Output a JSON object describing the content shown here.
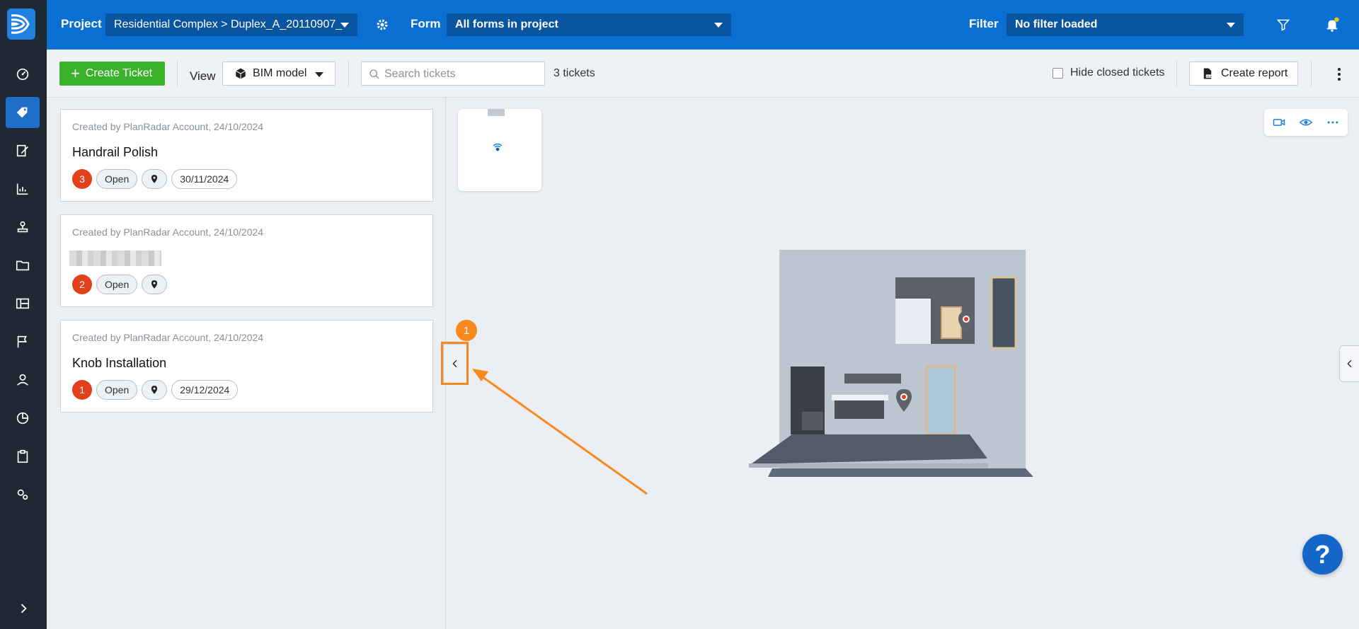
{
  "topbar": {
    "project_label": "Project",
    "project_value": "Residential Complex > Duplex_A_20110907_",
    "form_label": "Form",
    "form_value": "All forms in project",
    "filter_label": "Filter",
    "filter_value": "No filter loaded"
  },
  "toolbar": {
    "create_ticket_label": "Create Ticket",
    "view_label": "View",
    "view_value": "BIM model",
    "search_placeholder": "Search tickets",
    "ticket_count": "3 tickets",
    "hide_closed_label": "Hide closed tickets",
    "create_report_label": "Create report"
  },
  "sidenav": {
    "items": [
      {
        "icon": "dashboard-icon"
      },
      {
        "icon": "tickets-tag-icon",
        "active": true
      },
      {
        "icon": "forms-edit-icon"
      },
      {
        "icon": "statistics-chart-icon"
      },
      {
        "icon": "location-stamp-icon"
      },
      {
        "icon": "folder-icon"
      },
      {
        "icon": "plans-icon"
      },
      {
        "icon": "flag-icon"
      },
      {
        "icon": "user-icon"
      },
      {
        "icon": "reports-pie-icon"
      },
      {
        "icon": "clipboard-icon"
      },
      {
        "icon": "settings-gears-icon"
      }
    ]
  },
  "tickets": [
    {
      "meta": "Created by PlanRadar Account, 24/10/2024",
      "title": "Handrail Polish",
      "priority": "3",
      "status": "Open",
      "due_date": "30/11/2024"
    },
    {
      "meta": "Created by PlanRadar Account, 24/10/2024",
      "title": "",
      "title_redacted": true,
      "priority": "2",
      "status": "Open"
    },
    {
      "meta": "Created by PlanRadar Account, 24/10/2024",
      "title": "Knob Installation",
      "priority": "1",
      "status": "Open",
      "due_date": "29/12/2024"
    }
  ],
  "annotation": {
    "step_number": "1",
    "color": "#f7891f"
  },
  "help_button_label": "?",
  "colors": {
    "topbar": "#0b6fd1",
    "sidenav": "#1f2933",
    "create_button": "#3bb22c",
    "priority_badge": "#e2401b"
  }
}
